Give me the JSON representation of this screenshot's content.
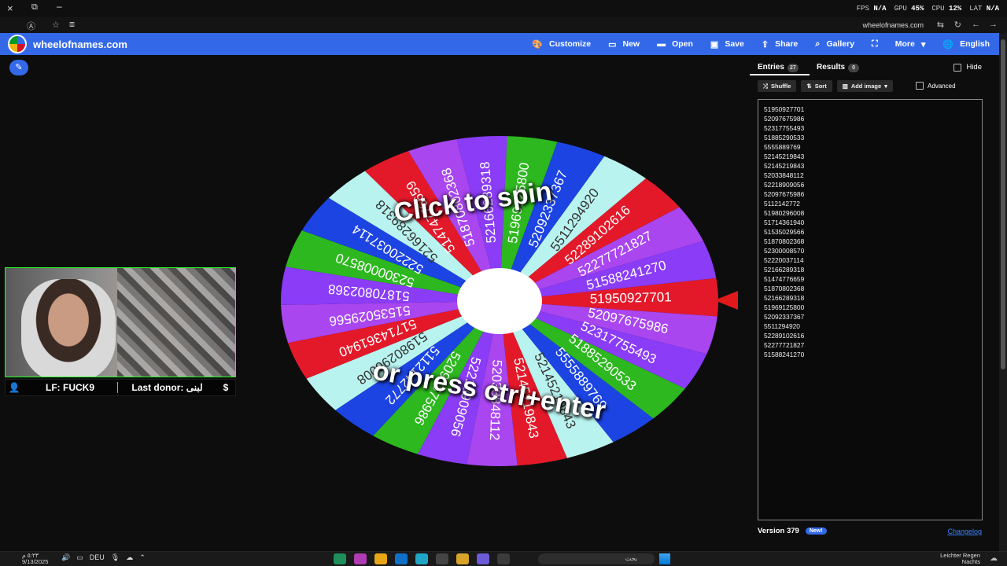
{
  "window": {
    "close_icon": "×",
    "restore_icon": "⧉",
    "minimize_icon": "–",
    "stats": {
      "fps_label": "FPS",
      "fps_value": "N/A",
      "gpu_label": "GPU",
      "gpu_value": "45%",
      "cpu_label": "CPU",
      "cpu_value": "12%",
      "lat_label": "LAT",
      "lat_value": "N/A"
    }
  },
  "address_bar": {
    "url": "wheelofnames.com"
  },
  "navbar": {
    "brand": "wheelofnames.com",
    "items": [
      "Customize",
      "New",
      "Open",
      "Save",
      "Share",
      "Gallery",
      "",
      "More",
      "English"
    ]
  },
  "wheel": {
    "overlay_line1": "Click to spin",
    "overlay_line2": "or press ctrl+enter",
    "segment_colors": [
      "#e3192a",
      "#a946f0",
      "#8a3cf7",
      "#2db81f",
      "#1c44e3",
      "#b9f3ef"
    ]
  },
  "webcam": {
    "lf_label": "LF: FUCK9",
    "donor_label": "Last donor: لبنى",
    "dollar": "$",
    "user_icon": "👤"
  },
  "panel": {
    "tabs": {
      "entries_label": "Entries",
      "entries_count": "27",
      "results_label": "Results",
      "results_count": "0"
    },
    "hide_label": "Hide",
    "tools": {
      "shuffle_label": "Shuffle",
      "sort_label": "Sort",
      "add_image_label": "Add image",
      "advanced_label": "Advanced"
    },
    "entries": [
      "51950927701",
      "52097675986",
      "52317755493",
      "51885290533",
      "5555889769",
      "52145219843",
      "52145219843",
      "52033848112",
      "52218909056",
      "52097675986",
      "5112142772",
      "51980296008",
      "51714361940",
      "51535029566",
      "51870802368",
      "52300008570",
      "52220037114",
      "52166289318",
      "51474776659",
      "51870802368",
      "52166289318",
      "51969125800",
      "52092337367",
      "5511294920",
      "52289102616",
      "52277721827",
      "51588241270"
    ],
    "version_label": "Version 379",
    "new_badge": "New!",
    "changelog_label": "Changelog"
  },
  "taskbar": {
    "time": "٥:٢٣ م",
    "date": "9/13/2025",
    "lang": "DEU",
    "search_placeholder": "بحث",
    "weather_line1": "Leichter Regen",
    "weather_line2": "Nachts"
  }
}
